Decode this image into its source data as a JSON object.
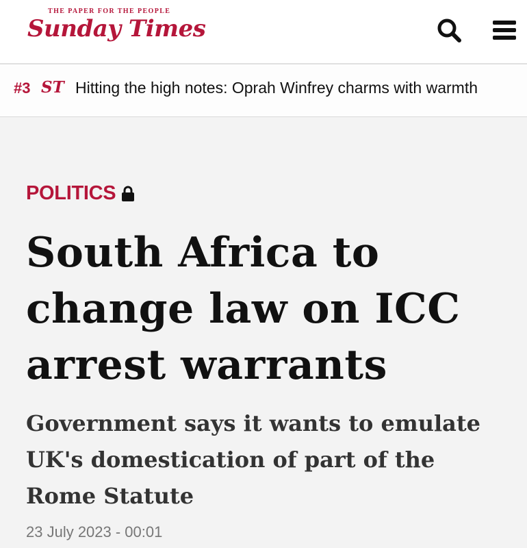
{
  "header": {
    "tagline": "The Paper For The People",
    "logo": "Sunday Times",
    "search_icon": "search-icon",
    "menu_icon": "hamburger-menu-icon"
  },
  "ticker": {
    "rank": "#3",
    "logo_mark": "ST",
    "text": "Hitting the high notes: Oprah Winfrey charms with warmth"
  },
  "article": {
    "section": "POLITICS",
    "section_icon": "lock-icon",
    "headline": "South Africa to change law on ICC arrest warrants",
    "standfirst": "Government says it wants to emulate UK's domestication of part of the Rome Statute",
    "date": "23 July 2023 - 00:01"
  },
  "colors": {
    "brand": "#b5163a",
    "headline": "#111111",
    "standfirst": "#333333",
    "date": "#777777",
    "background": "#f3f3f3"
  }
}
